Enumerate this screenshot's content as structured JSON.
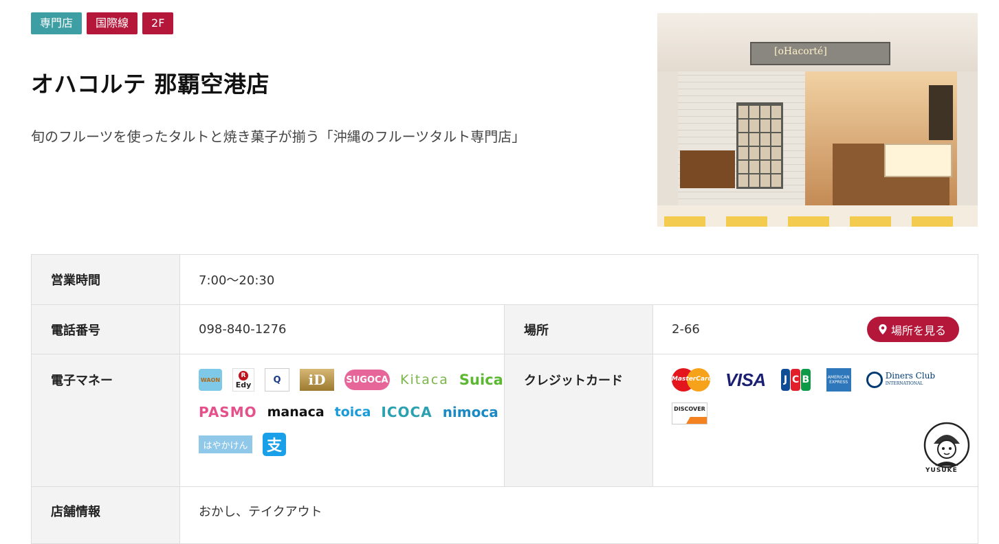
{
  "tags": [
    {
      "label": "専門店",
      "color": "#3d9ea4"
    },
    {
      "label": "国際線",
      "color": "#b5173a"
    },
    {
      "label": "2F",
      "color": "#b5173a"
    }
  ],
  "shop": {
    "title": "オハコルテ 那覇空港店",
    "description": "旬のフルーツを使ったタルトと焼き菓子が揃う「沖縄のフルーツタルト専門店」",
    "photo_sign": "[oHacorté]"
  },
  "info": {
    "hours_label": "営業時間",
    "hours_value": "7:00〜20:30",
    "phone_label": "電話番号",
    "phone_value": "098-840-1276",
    "location_label": "場所",
    "location_value": "2-66",
    "map_button": "場所を見る",
    "emoney_label": "電子マネー",
    "credit_label": "クレジットカード",
    "store_label": "店舗情報",
    "store_value": "おかし、テイクアウト"
  },
  "emoney": {
    "waon": "WAON",
    "edy": "Edy",
    "edy_mark": "R",
    "quicpay": "Q",
    "id": "iD",
    "sugoca": "SUGOCA",
    "kitaca": "Kitaca",
    "suica": "Suica",
    "pasmo": "PASMO",
    "manaca": "manaca",
    "toica": "toica",
    "icoca": "ICOCA",
    "nimoca": "nimoca",
    "hayakaken": "はやかけん",
    "alipay": "支"
  },
  "cards": {
    "mastercard": "MasterCard",
    "visa": "VISA",
    "jcb": [
      "J",
      "C",
      "B"
    ],
    "amex": "AMERICAN EXPRESS",
    "diners": "Diners Club",
    "diners_sub": "INTERNATIONAL",
    "discover": "DISCOVER"
  },
  "watermark": {
    "label": "YUSUKE"
  },
  "colors": {
    "accent": "#b5173a",
    "teal": "#3d9ea4",
    "header_cell": "#f3f3f3",
    "border": "#dddddd"
  }
}
